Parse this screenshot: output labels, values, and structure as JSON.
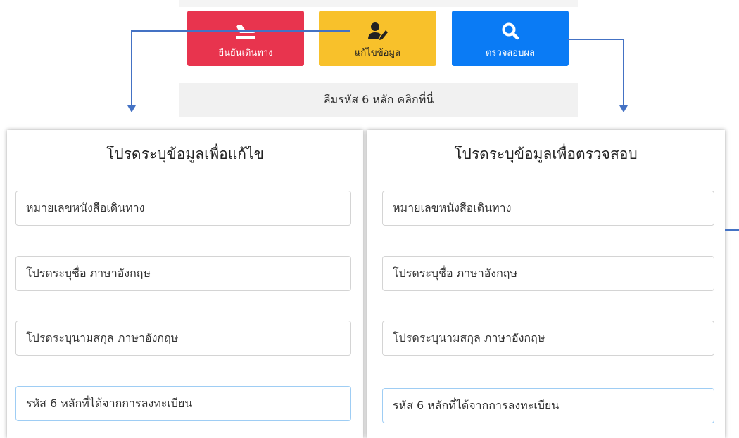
{
  "actions": {
    "confirm": {
      "label": "ยืนยันเดินทาง",
      "icon": "plane-arrival-icon",
      "color": "#e8344e"
    },
    "edit": {
      "label": "แก้ไขข้อมูล",
      "icon": "user-edit-icon",
      "color": "#f8c12b"
    },
    "check": {
      "label": "ตรวจสอบผล",
      "icon": "search-icon",
      "color": "#0a7bf5"
    }
  },
  "forgot_link": "ลืมรหัส 6 หลัก คลิกที่นี่",
  "edit_panel": {
    "title": "โปรดระบุข้อมูลเพื่อแก้ไข",
    "fields": [
      "หมายเลขหนังสือเดินทาง",
      "โปรดระบุชื่อ ภาษาอังกฤษ",
      "โปรดระบุนามสกุล ภาษาอังกฤษ",
      "รหัส 6 หลักที่ได้จากการลงทะเบียน"
    ]
  },
  "check_panel": {
    "title": "โปรดระบุข้อมูลเพื่อตรวจสอบ",
    "fields": [
      "หมายเลขหนังสือเดินทาง",
      "โปรดระบุชื่อ ภาษาอังกฤษ",
      "โปรดระบุนามสกุล ภาษาอังกฤษ",
      "รหัส 6 หลักที่ได้จากการลงทะเบียน"
    ]
  },
  "connector_color": "#4472c4"
}
